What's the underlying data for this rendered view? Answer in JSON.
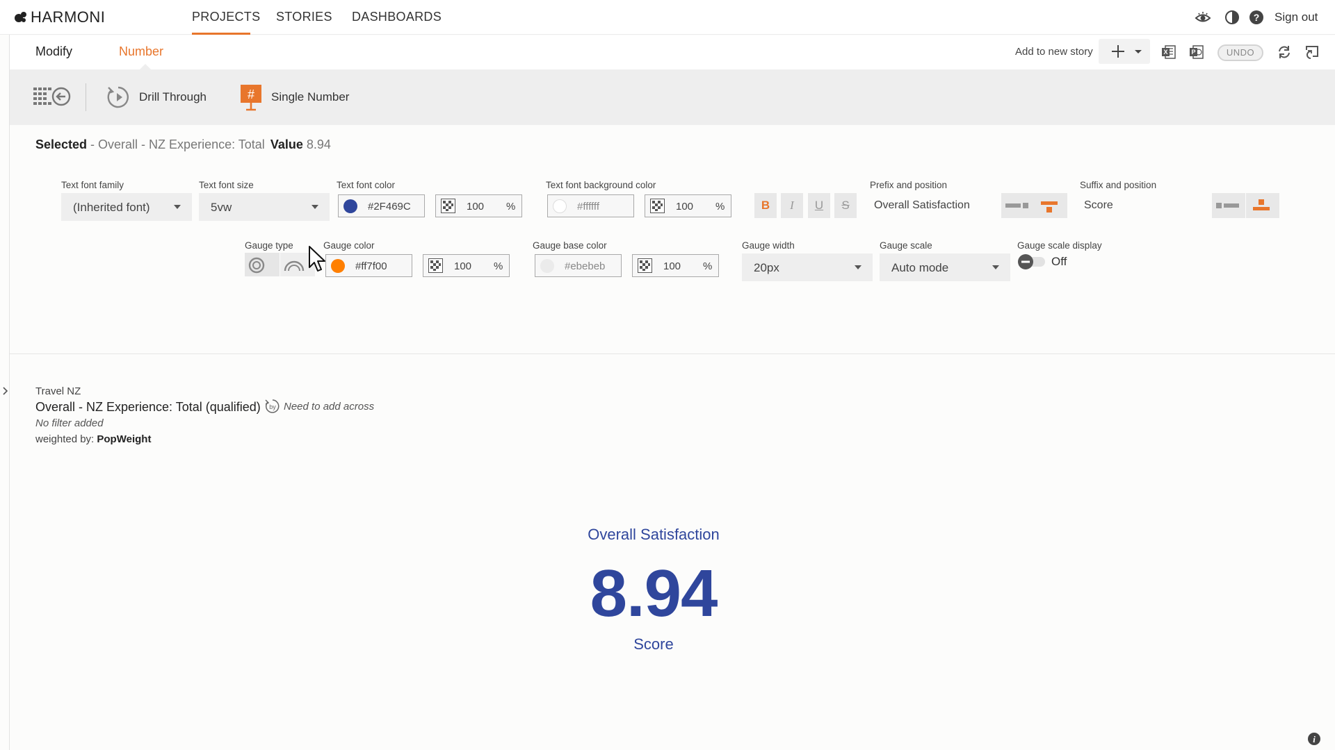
{
  "app": {
    "brand": "HARMONI"
  },
  "nav": {
    "projects": "PROJECTS",
    "stories": "STORIES",
    "dashboards": "DASHBOARDS",
    "sign_out": "Sign out"
  },
  "modify_bar": {
    "modify": "Modify",
    "number": "Number",
    "add_to_story": "Add to new story",
    "undo": "UNDO"
  },
  "toolbar": {
    "drill_through": "Drill Through",
    "single_number": "Single Number"
  },
  "selected": {
    "label": "Selected",
    "item": " - Overall - NZ Experience: Total",
    "value_label": "Value",
    "value": " 8.94"
  },
  "props": {
    "text_font_family": {
      "label": "Text font family",
      "value": "(Inherited font)"
    },
    "text_font_size": {
      "label": "Text font size",
      "value": "5vw"
    },
    "text_font_color": {
      "label": "Text font color",
      "value": "#2F469C",
      "opacity": "100",
      "unit": "%"
    },
    "text_font_bg_color": {
      "label": "Text font background color",
      "value": "#ffffff",
      "opacity": "100",
      "unit": "%"
    },
    "format_buttons": {
      "bold": "B",
      "italic": "I",
      "underline": "U",
      "strike": "S"
    },
    "prefix": {
      "label": "Prefix and position",
      "value": "Overall Satisfaction"
    },
    "suffix": {
      "label": "Suffix and position",
      "value": "Score"
    },
    "gauge_type": {
      "label": "Gauge type"
    },
    "gauge_color": {
      "label": "Gauge color",
      "value": "#ff7f00",
      "opacity": "100",
      "unit": "%"
    },
    "gauge_base_color": {
      "label": "Gauge base color",
      "value": "#ebebeb",
      "opacity": "100",
      "unit": "%"
    },
    "gauge_width": {
      "label": "Gauge width",
      "value": "20px"
    },
    "gauge_scale": {
      "label": "Gauge scale",
      "value": "Auto mode"
    },
    "gauge_scale_display": {
      "label": "Gauge scale display",
      "value": "Off"
    }
  },
  "info": {
    "project": "Travel NZ",
    "title": "Overall - NZ Experience: Total (qualified)",
    "need_across": "Need to add across",
    "filter": "No filter added",
    "weighted_by_label": "weighted by: ",
    "weighted_by_value": "PopWeight"
  },
  "widget": {
    "prefix": "Overall Satisfaction",
    "value": "8.94",
    "suffix": "Score"
  },
  "colors": {
    "accent": "#e8762c",
    "text_color": "#2F469C",
    "gauge_color": "#ff7f00",
    "gauge_base": "#ebebeb"
  }
}
